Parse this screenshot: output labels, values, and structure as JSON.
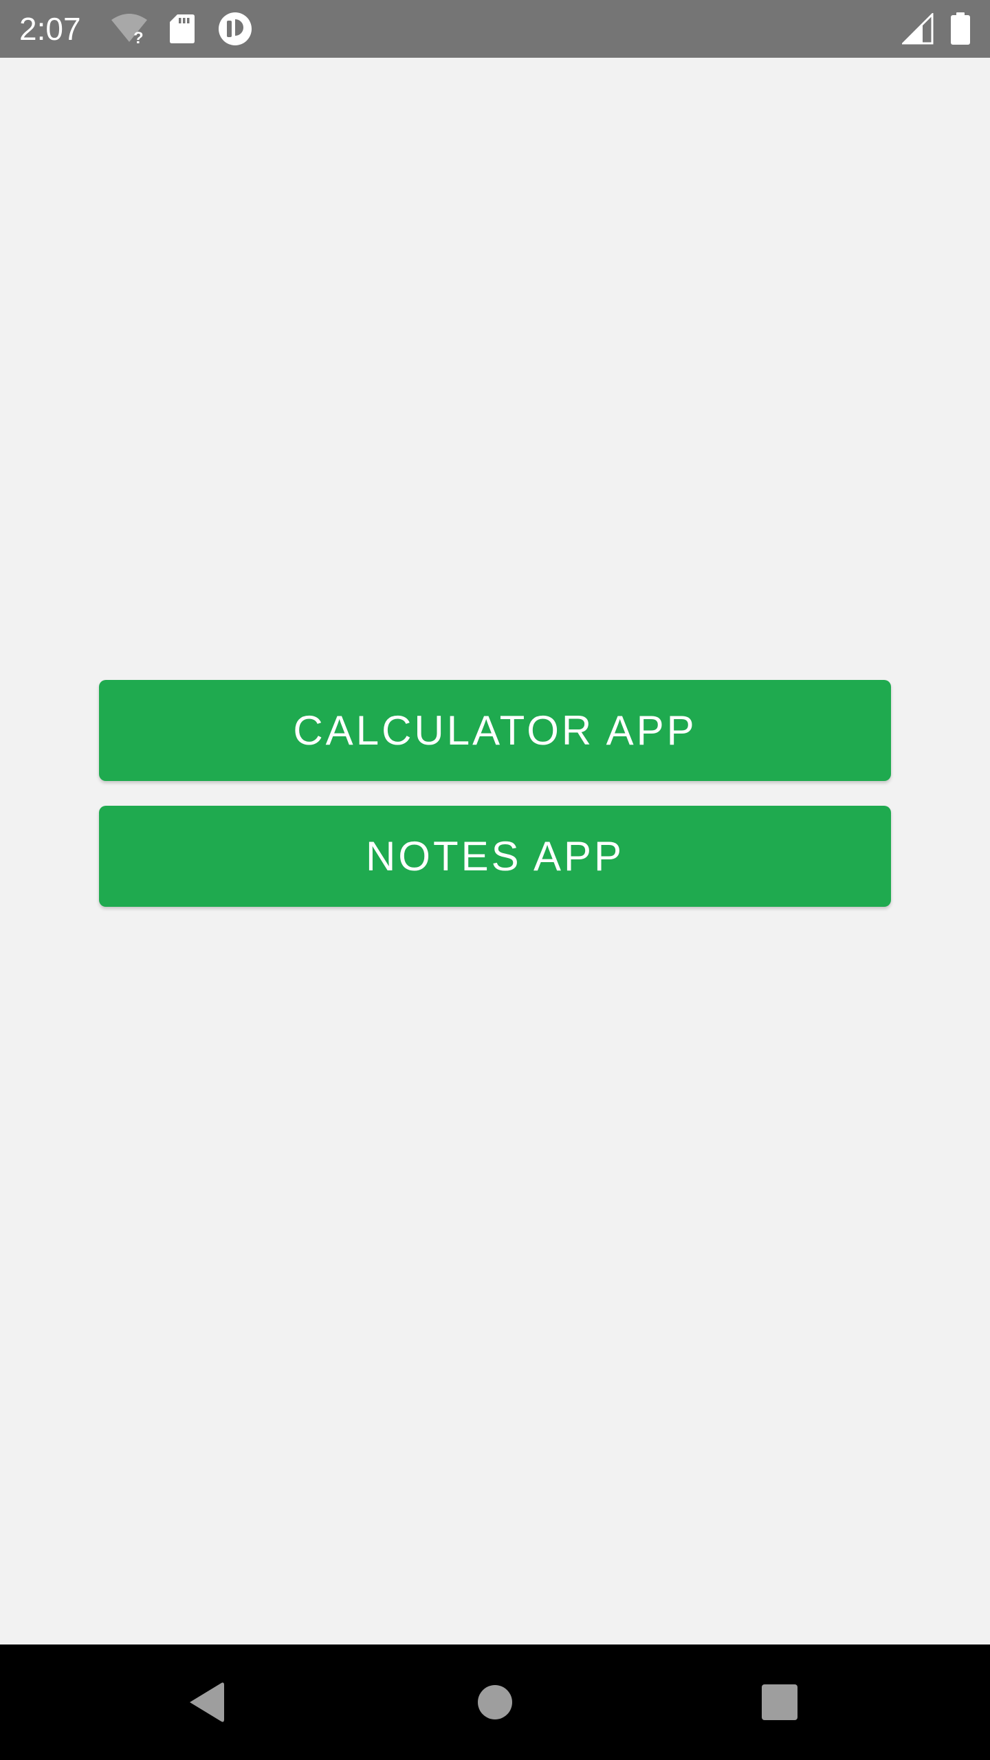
{
  "status_bar": {
    "time": "2:07",
    "icons": [
      "wifi-unknown-icon",
      "sd-card-icon",
      "sync-circle-icon",
      "cell-signal-icon",
      "battery-icon"
    ]
  },
  "main": {
    "buttons": [
      {
        "label": "CALCULATOR APP"
      },
      {
        "label": "NOTES APP"
      }
    ]
  },
  "nav_bar": {
    "icons": [
      "back-icon",
      "home-icon",
      "recents-icon"
    ]
  },
  "colors": {
    "status_bar_bg": "#757575",
    "background": "#f2f2f2",
    "button_green": "#1faa4f",
    "nav_bar_bg": "#000000",
    "nav_icon": "#9e9e9e"
  }
}
